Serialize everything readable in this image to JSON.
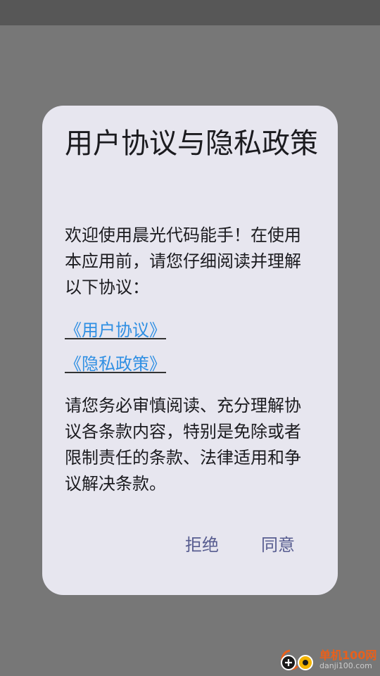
{
  "dialog": {
    "title": "用户协议与隐私政策",
    "intro": "欢迎使用晨光代码能手！在使用本应用前，请您仔细阅读并理解以下协议：",
    "links": [
      {
        "label": "《用户协议》"
      },
      {
        "label": "《隐私政策》"
      }
    ],
    "notice": "请您务必审慎阅读、充分理解协议各条款内容，特别是免除或者限制责任的条款、法律适用和争议解决条款。",
    "buttons": {
      "reject": "拒绝",
      "agree": "同意"
    }
  },
  "watermark": {
    "name": "单机100网",
    "domain": "danji100.com"
  },
  "colors": {
    "scrim": "#777777",
    "status_bar": "#575757",
    "dialog_bg": "#e7e6ef",
    "link": "#2f8fe3",
    "button_text": "#585d90",
    "watermark_accent": "#e8601c"
  }
}
